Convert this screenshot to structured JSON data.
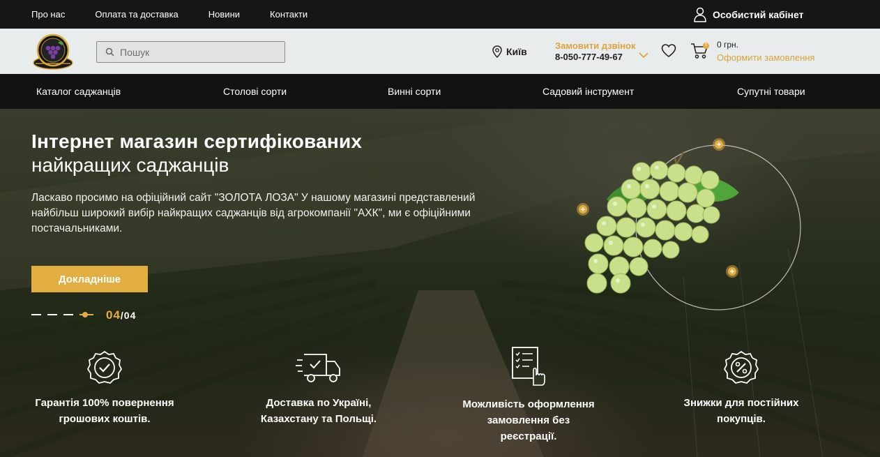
{
  "topbar": {
    "links": [
      "Про нас",
      "Оплата та доставка",
      "Новини",
      "Контакти"
    ],
    "account_label": "Особистий кабінет"
  },
  "header": {
    "search_placeholder": "Пошук",
    "city": "Київ",
    "callback_label": "Замовити дзвінок",
    "phone": "8-050-777-49-67",
    "cart_count": "0",
    "cart_sum": "0 грн.",
    "checkout_label": "Оформити замовлення"
  },
  "mainnav": {
    "items": [
      "Каталог саджанців",
      "Столові сорти",
      "Винні сорти",
      "Садовий інструмент",
      "Супутні товари"
    ]
  },
  "hero": {
    "title_bold": "Інтернет магазин сертифікованих",
    "title_light": "найкращих саджанців",
    "text": "Ласкаво просимо на офіційний сайт \"ЗОЛОТА ЛОЗА\" У нашому магазині представлений найбільш широкий вибір найкращих саджанців від агрокомпанії \"АХК\", ми є офіційними постачальниками.",
    "button_label": "Докладніше",
    "slide_current": "04",
    "slide_total": "/04"
  },
  "features": [
    {
      "icon": "guarantee-check-icon",
      "line1": "Гарантія 100% повернення",
      "line2": "грошових коштів.",
      "line3": ""
    },
    {
      "icon": "delivery-truck-icon",
      "line1": "Доставка по Україні,",
      "line2": "Казахстану та Польщі.",
      "line3": ""
    },
    {
      "icon": "checklist-hand-icon",
      "line1": "Можливість оформлення",
      "line2": "замовлення без",
      "line3": "реєстрації."
    },
    {
      "icon": "discount-badge-icon",
      "line1": "Знижки для постійних",
      "line2": "покупців.",
      "line3": ""
    }
  ],
  "colors": {
    "accent": "#e3ae41",
    "topbar": "#161616",
    "header": "#e9ecec",
    "nav": "#121212"
  }
}
